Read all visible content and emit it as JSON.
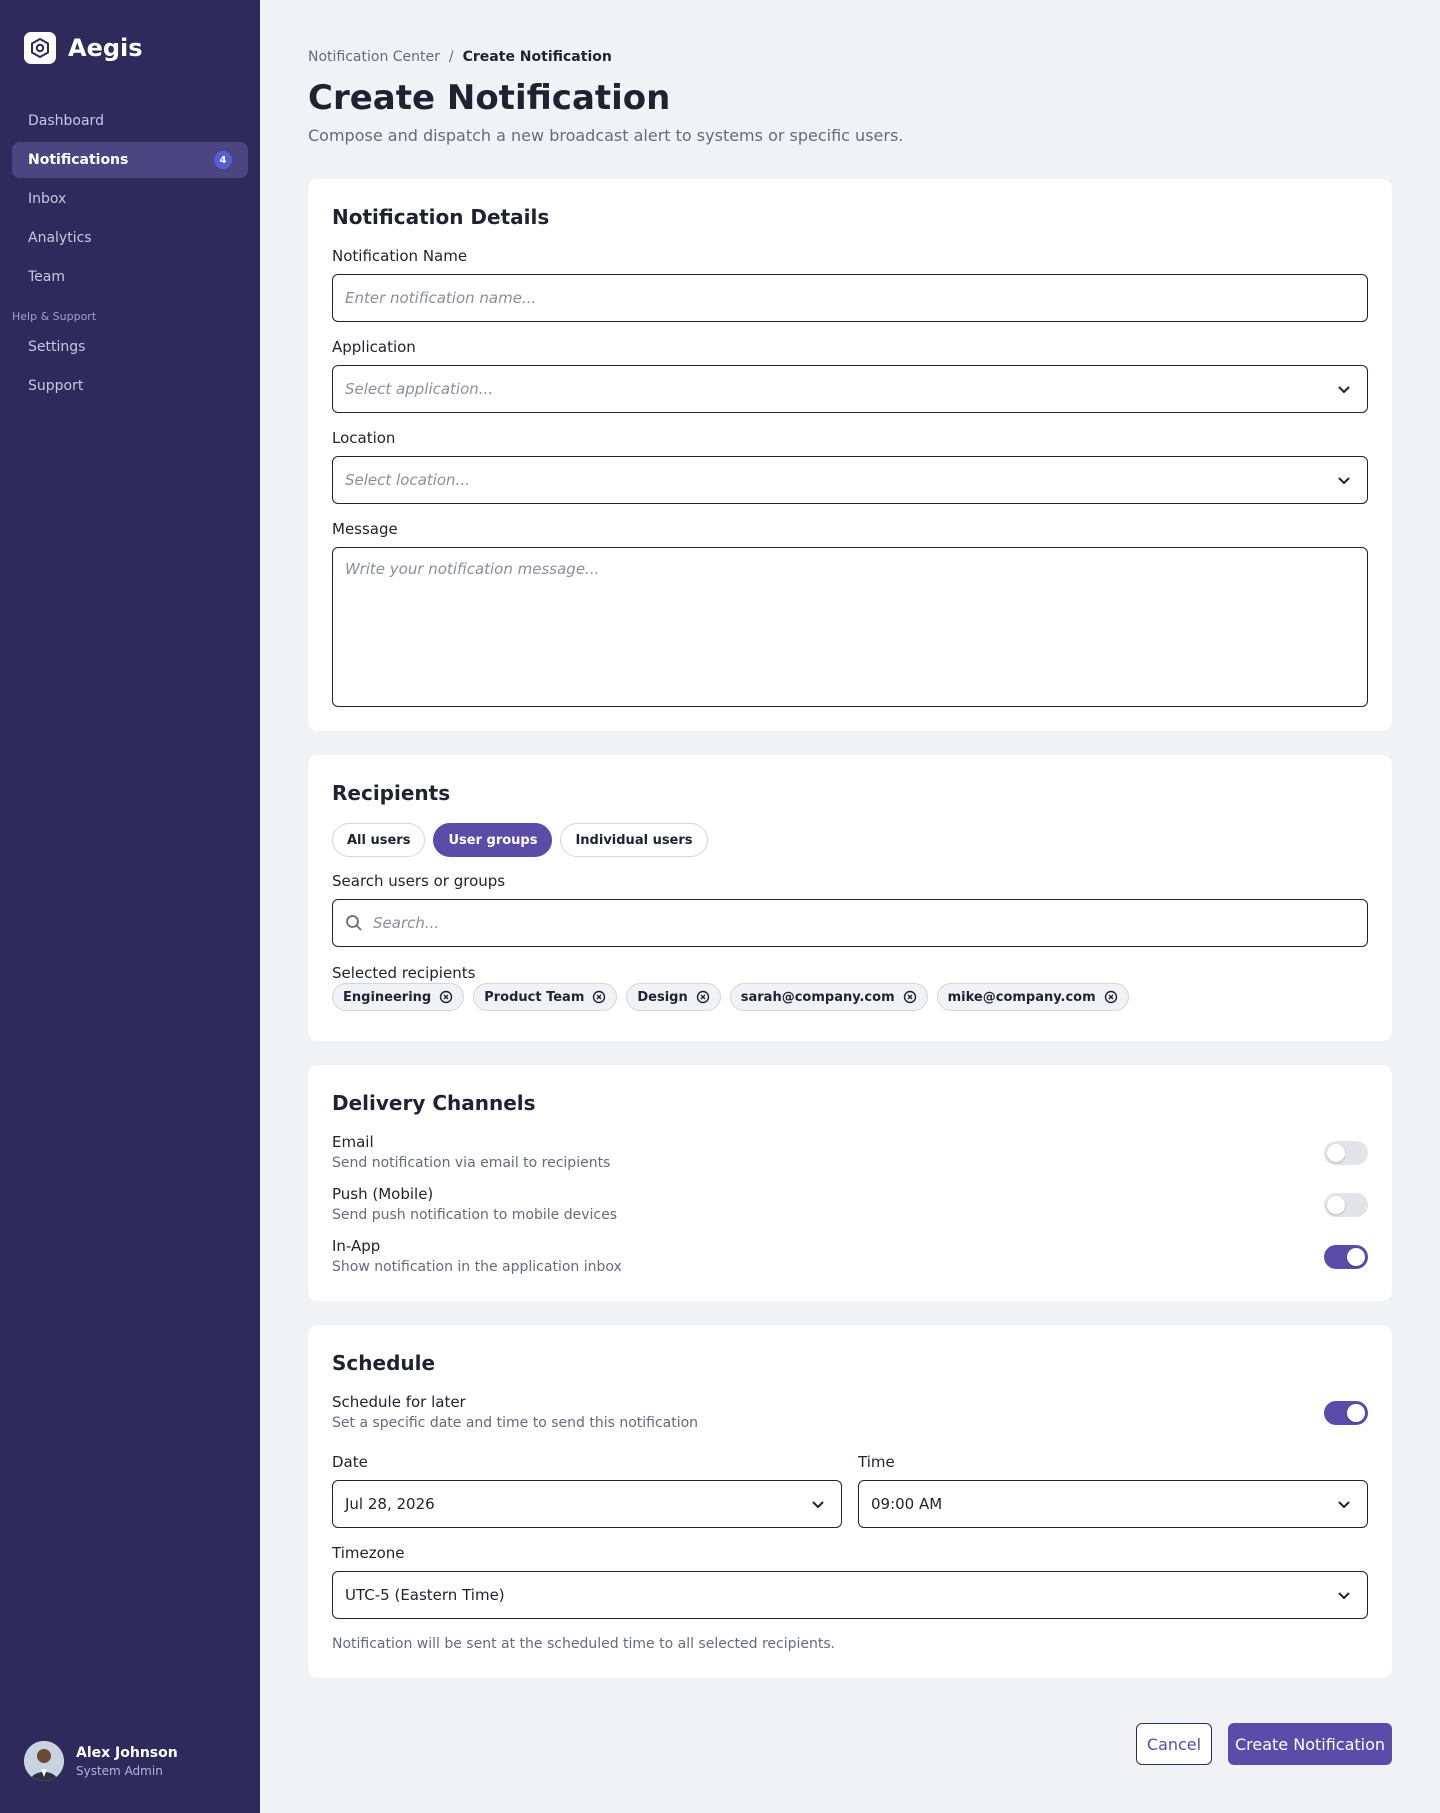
{
  "app": {
    "name": "Aegis"
  },
  "sidebar": {
    "items": [
      {
        "label": "Dashboard"
      },
      {
        "label": "Notifications",
        "badge": "4"
      },
      {
        "label": "Inbox"
      },
      {
        "label": "Analytics"
      },
      {
        "label": "Team"
      }
    ],
    "section_label": "Help & Support",
    "support_items": [
      {
        "label": "Settings"
      },
      {
        "label": "Support"
      }
    ],
    "user": {
      "name": "Alex Johnson",
      "role": "System Admin"
    }
  },
  "header": {
    "breadcrumb_parent": "Notification Center",
    "breadcrumb_separator": "/",
    "breadcrumb_current": "Create Notification",
    "title": "Create Notification",
    "subtitle": "Compose and dispatch a new broadcast alert to systems or specific users."
  },
  "details": {
    "title": "Notification Details",
    "name_label": "Notification Name",
    "name_placeholder": "Enter notification name...",
    "app_label": "Application",
    "app_placeholder": "Select application...",
    "location_label": "Location",
    "location_placeholder": "Select location...",
    "message_label": "Message",
    "message_placeholder": "Write your notification message..."
  },
  "recipients": {
    "title": "Recipients",
    "tabs": [
      {
        "label": "All users",
        "active": false
      },
      {
        "label": "User groups",
        "active": true
      },
      {
        "label": "Individual users",
        "active": false
      }
    ],
    "search_label": "Search users or groups",
    "search_placeholder": "Search...",
    "selected_label": "Selected recipients",
    "selected": [
      "Engineering",
      "Product Team",
      "Design",
      "sarah@company.com",
      "mike@company.com"
    ]
  },
  "channels": {
    "title": "Delivery Channels",
    "items": [
      {
        "title": "Email",
        "desc": "Send notification via email to recipients",
        "enabled": false
      },
      {
        "title": "Push (Mobile)",
        "desc": "Send push notification to mobile devices",
        "enabled": false
      },
      {
        "title": "In-App",
        "desc": "Show notification in the application inbox",
        "enabled": true
      }
    ]
  },
  "schedule": {
    "title": "Schedule",
    "later_title": "Schedule for later",
    "later_desc": "Set a specific date and time to send this notification",
    "later_enabled": true,
    "date_label": "Date",
    "date_value": "Jul 28, 2026",
    "time_label": "Time",
    "time_value": "09:00 AM",
    "tz_label": "Timezone",
    "tz_value": "UTC-5 (Eastern Time)",
    "note": "Notification will be sent at the scheduled time to all selected recipients."
  },
  "actions": {
    "cancel": "Cancel",
    "submit": "Create Notification"
  },
  "colors": {
    "sidebar_bg": "#2e2a5c",
    "accent": "#5b4caa",
    "badge": "#5b5bd6"
  },
  "icons": [
    "logo-icon",
    "chevron-down-icon",
    "search-icon",
    "remove-chip-icon"
  ]
}
